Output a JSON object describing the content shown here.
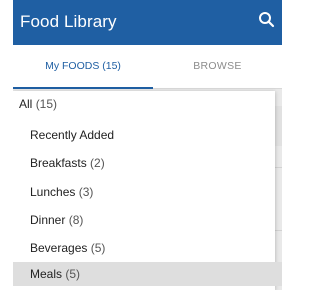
{
  "app": {
    "title": "Food Library",
    "search_icon": "search-icon"
  },
  "tabs": [
    {
      "label": "My FOODS (15)",
      "active": true
    },
    {
      "label": "BROWSE",
      "active": false
    }
  ],
  "dropdown": {
    "items": [
      {
        "label": "All",
        "count": "(15)"
      },
      {
        "label": "Recently Added",
        "count": ""
      },
      {
        "label": "Breakfasts",
        "count": "(2)"
      },
      {
        "label": "Lunches",
        "count": "(3)"
      },
      {
        "label": "Dinner",
        "count": "(8)"
      },
      {
        "label": "Beverages",
        "count": "(5)"
      },
      {
        "label": "Meals",
        "count": "(5)"
      }
    ]
  },
  "colors": {
    "primary": "#1f5fa3",
    "inactive_tab": "#8c8c8c",
    "selected_item": "#dedede"
  }
}
